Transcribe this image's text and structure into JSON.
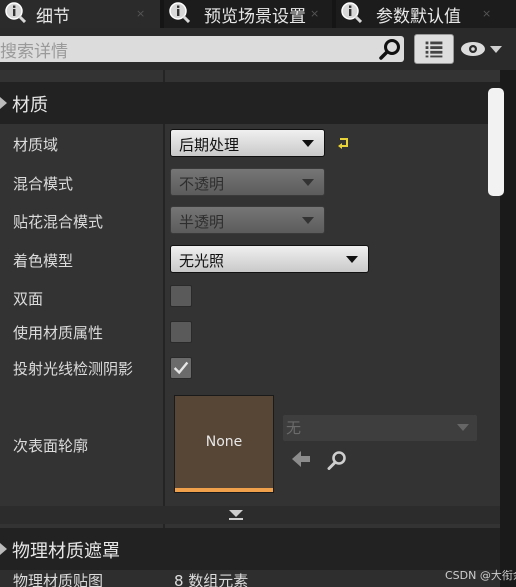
{
  "tabs": [
    {
      "label": "细节",
      "close": "×"
    },
    {
      "label": "预览场景设置",
      "close": "×"
    },
    {
      "label": "参数默认值",
      "close": "×"
    }
  ],
  "search": {
    "placeholder": "搜索详情"
  },
  "sections": {
    "material": "材质",
    "physical_mask": "物理材质遮罩"
  },
  "properties": {
    "material_domain": {
      "label": "材质域",
      "value": "后期处理"
    },
    "blend_mode": {
      "label": "混合模式",
      "value": "不透明"
    },
    "decal_blend_mode": {
      "label": "贴花混合模式",
      "value": "半透明"
    },
    "shading_model": {
      "label": "着色模型",
      "value": "无光照"
    },
    "two_sided": {
      "label": "双面",
      "checked": false
    },
    "use_material_attributes": {
      "label": "使用材质属性",
      "checked": false
    },
    "cast_ray_traced_shadows": {
      "label": "投射光线检测阴影",
      "checked": true
    },
    "subsurface_profile": {
      "label": "次表面轮廓",
      "thumbnail": "None",
      "asset": "无"
    },
    "physical_material_map": {
      "label": "物理材质贴图",
      "value": "8 数组元素"
    }
  },
  "watermark": "CSDN @大衔余",
  "colors": {
    "accent_orange": "#f0a04b",
    "reset_yellow": "#e8d23a"
  }
}
